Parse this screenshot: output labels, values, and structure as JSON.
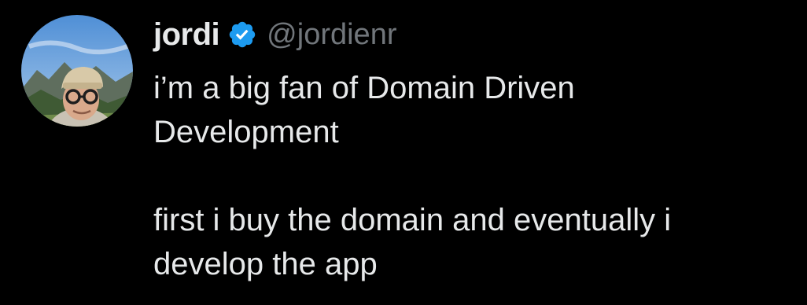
{
  "tweet": {
    "author": {
      "display_name": "jordi",
      "handle": "@jordienr",
      "verified": true,
      "verified_icon": "verified-badge-icon",
      "verified_color": "#1d9bf0"
    },
    "text": {
      "paragraph_1_line_1": "i’m a big fan of Domain Driven",
      "paragraph_1_line_2": "Development",
      "paragraph_2_line_1": "first i buy the domain and eventually i",
      "paragraph_2_line_2": "develop the app"
    }
  },
  "colors": {
    "background": "#000000",
    "text_primary": "#e7e9ea",
    "text_secondary": "#71767b",
    "accent": "#1d9bf0"
  }
}
